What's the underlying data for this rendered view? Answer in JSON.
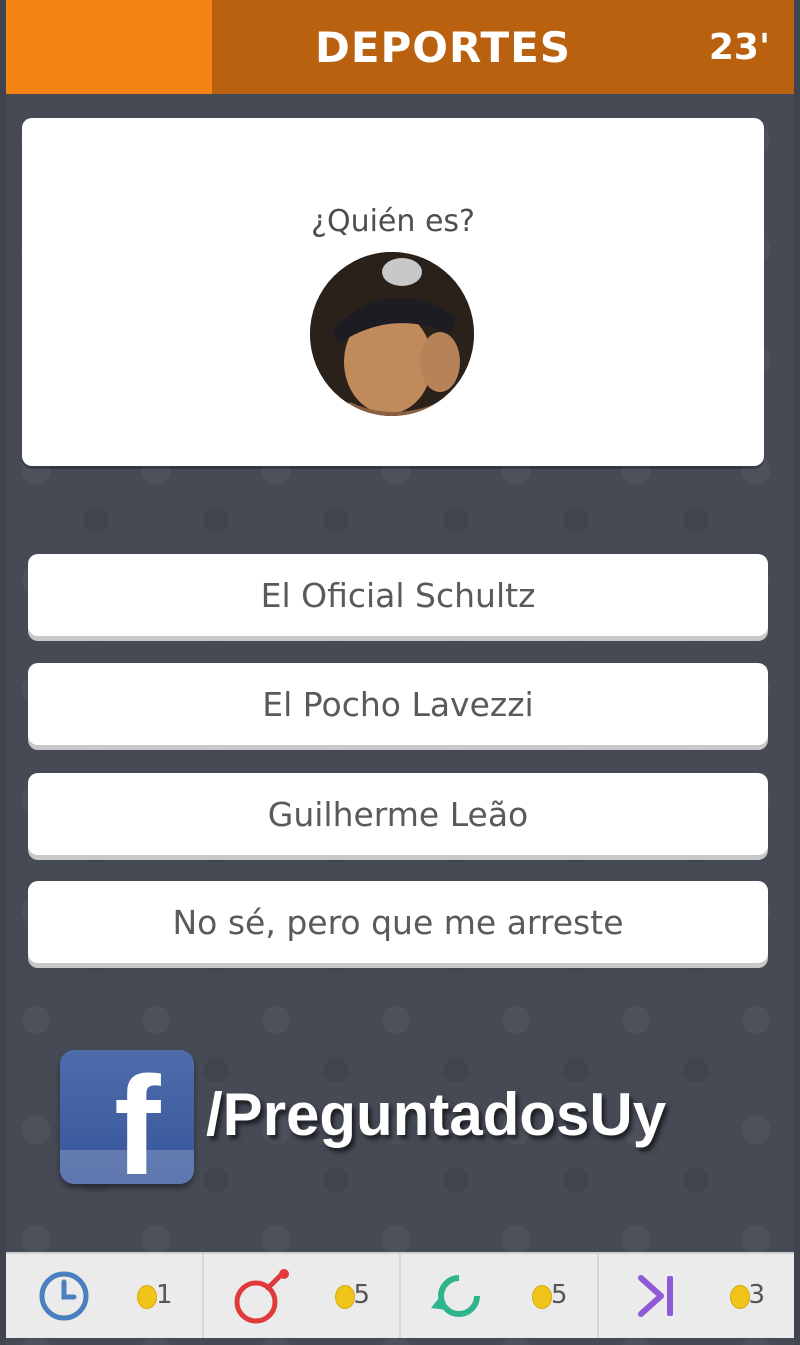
{
  "header": {
    "category": "DEPORTES",
    "timer": "23'",
    "colors": {
      "accent": "#f58312",
      "bar": "#b9610f"
    }
  },
  "question": {
    "text": "¿Quién es?",
    "image": "portrait-photo"
  },
  "answers": [
    {
      "label": "El Oficial Schultz"
    },
    {
      "label": "El Pocho Lavezzi"
    },
    {
      "label": "Guilherme Leão"
    },
    {
      "label": "No sé, pero que me arreste"
    }
  ],
  "promo": {
    "icon": "facebook-icon",
    "handle": "/PreguntadosUy"
  },
  "powerups": [
    {
      "name": "time-icon",
      "count": "1",
      "color": "#4a7fc1"
    },
    {
      "name": "bomb-icon",
      "count": "5",
      "color": "#e03a3a"
    },
    {
      "name": "refresh-icon",
      "count": "5",
      "color": "#2fb58d"
    },
    {
      "name": "skip-icon",
      "count": "3",
      "color": "#8f5ad6"
    }
  ]
}
